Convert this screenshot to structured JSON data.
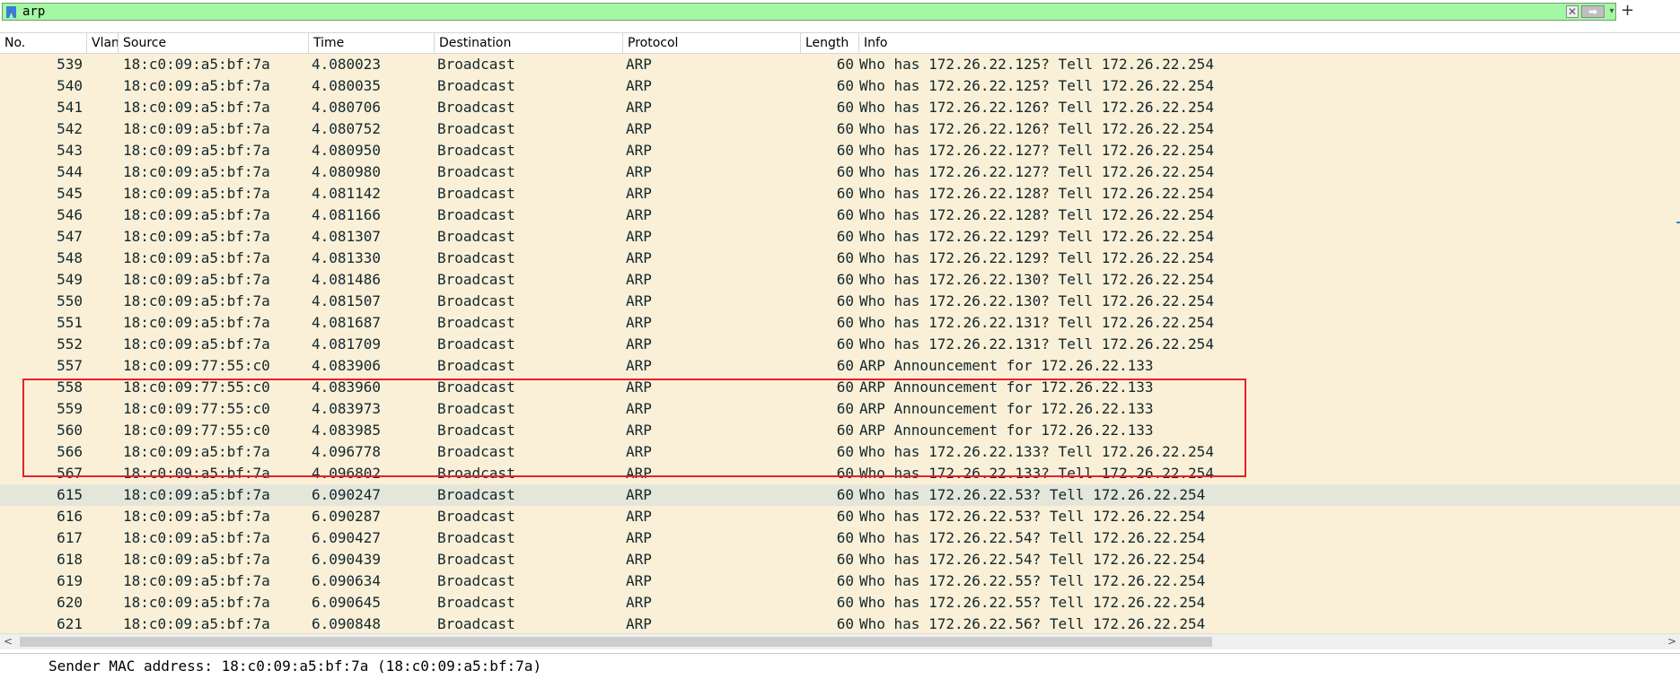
{
  "filter": {
    "value": "arp",
    "icons": [
      "bookmark-icon",
      "clear-icon",
      "apply-arrow-icon",
      "dropdown-icon",
      "plus-icon"
    ],
    "clear_glyph": "✕",
    "apply_glyph": "➡",
    "dropdown_glyph": "▾",
    "plus_glyph": "+"
  },
  "columns": [
    "No.",
    "Vlan",
    "Source",
    "Time",
    "Destination",
    "Protocol",
    "Length",
    "Info"
  ],
  "packets": [
    {
      "no": "539",
      "source": "18:c0:09:a5:bf:7a",
      "time": "4.080023",
      "destination": "Broadcast",
      "protocol": "ARP",
      "length": "60",
      "info": "Who has 172.26.22.125? Tell 172.26.22.254"
    },
    {
      "no": "540",
      "source": "18:c0:09:a5:bf:7a",
      "time": "4.080035",
      "destination": "Broadcast",
      "protocol": "ARP",
      "length": "60",
      "info": "Who has 172.26.22.125? Tell 172.26.22.254"
    },
    {
      "no": "541",
      "source": "18:c0:09:a5:bf:7a",
      "time": "4.080706",
      "destination": "Broadcast",
      "protocol": "ARP",
      "length": "60",
      "info": "Who has 172.26.22.126? Tell 172.26.22.254"
    },
    {
      "no": "542",
      "source": "18:c0:09:a5:bf:7a",
      "time": "4.080752",
      "destination": "Broadcast",
      "protocol": "ARP",
      "length": "60",
      "info": "Who has 172.26.22.126? Tell 172.26.22.254"
    },
    {
      "no": "543",
      "source": "18:c0:09:a5:bf:7a",
      "time": "4.080950",
      "destination": "Broadcast",
      "protocol": "ARP",
      "length": "60",
      "info": "Who has 172.26.22.127? Tell 172.26.22.254"
    },
    {
      "no": "544",
      "source": "18:c0:09:a5:bf:7a",
      "time": "4.080980",
      "destination": "Broadcast",
      "protocol": "ARP",
      "length": "60",
      "info": "Who has 172.26.22.127? Tell 172.26.22.254"
    },
    {
      "no": "545",
      "source": "18:c0:09:a5:bf:7a",
      "time": "4.081142",
      "destination": "Broadcast",
      "protocol": "ARP",
      "length": "60",
      "info": "Who has 172.26.22.128? Tell 172.26.22.254"
    },
    {
      "no": "546",
      "source": "18:c0:09:a5:bf:7a",
      "time": "4.081166",
      "destination": "Broadcast",
      "protocol": "ARP",
      "length": "60",
      "info": "Who has 172.26.22.128? Tell 172.26.22.254"
    },
    {
      "no": "547",
      "source": "18:c0:09:a5:bf:7a",
      "time": "4.081307",
      "destination": "Broadcast",
      "protocol": "ARP",
      "length": "60",
      "info": "Who has 172.26.22.129? Tell 172.26.22.254"
    },
    {
      "no": "548",
      "source": "18:c0:09:a5:bf:7a",
      "time": "4.081330",
      "destination": "Broadcast",
      "protocol": "ARP",
      "length": "60",
      "info": "Who has 172.26.22.129? Tell 172.26.22.254"
    },
    {
      "no": "549",
      "source": "18:c0:09:a5:bf:7a",
      "time": "4.081486",
      "destination": "Broadcast",
      "protocol": "ARP",
      "length": "60",
      "info": "Who has 172.26.22.130? Tell 172.26.22.254"
    },
    {
      "no": "550",
      "source": "18:c0:09:a5:bf:7a",
      "time": "4.081507",
      "destination": "Broadcast",
      "protocol": "ARP",
      "length": "60",
      "info": "Who has 172.26.22.130? Tell 172.26.22.254"
    },
    {
      "no": "551",
      "source": "18:c0:09:a5:bf:7a",
      "time": "4.081687",
      "destination": "Broadcast",
      "protocol": "ARP",
      "length": "60",
      "info": "Who has 172.26.22.131? Tell 172.26.22.254"
    },
    {
      "no": "552",
      "source": "18:c0:09:a5:bf:7a",
      "time": "4.081709",
      "destination": "Broadcast",
      "protocol": "ARP",
      "length": "60",
      "info": "Who has 172.26.22.131? Tell 172.26.22.254"
    },
    {
      "no": "557",
      "source": "18:c0:09:77:55:c0",
      "time": "4.083906",
      "destination": "Broadcast",
      "protocol": "ARP",
      "length": "60",
      "info": "ARP Announcement for 172.26.22.133"
    },
    {
      "no": "558",
      "source": "18:c0:09:77:55:c0",
      "time": "4.083960",
      "destination": "Broadcast",
      "protocol": "ARP",
      "length": "60",
      "info": "ARP Announcement for 172.26.22.133"
    },
    {
      "no": "559",
      "source": "18:c0:09:77:55:c0",
      "time": "4.083973",
      "destination": "Broadcast",
      "protocol": "ARP",
      "length": "60",
      "info": "ARP Announcement for 172.26.22.133"
    },
    {
      "no": "560",
      "source": "18:c0:09:77:55:c0",
      "time": "4.083985",
      "destination": "Broadcast",
      "protocol": "ARP",
      "length": "60",
      "info": "ARP Announcement for 172.26.22.133"
    },
    {
      "no": "566",
      "source": "18:c0:09:a5:bf:7a",
      "time": "4.096778",
      "destination": "Broadcast",
      "protocol": "ARP",
      "length": "60",
      "info": "Who has 172.26.22.133? Tell 172.26.22.254"
    },
    {
      "no": "567",
      "source": "18:c0:09:a5:bf:7a",
      "time": "4.096802",
      "destination": "Broadcast",
      "protocol": "ARP",
      "length": "60",
      "info": "Who has 172.26.22.133? Tell 172.26.22.254"
    },
    {
      "no": "615",
      "source": "18:c0:09:a5:bf:7a",
      "time": "6.090247",
      "destination": "Broadcast",
      "protocol": "ARP",
      "length": "60",
      "info": "Who has 172.26.22.53? Tell 172.26.22.254",
      "selected": true
    },
    {
      "no": "616",
      "source": "18:c0:09:a5:bf:7a",
      "time": "6.090287",
      "destination": "Broadcast",
      "protocol": "ARP",
      "length": "60",
      "info": "Who has 172.26.22.53? Tell 172.26.22.254"
    },
    {
      "no": "617",
      "source": "18:c0:09:a5:bf:7a",
      "time": "6.090427",
      "destination": "Broadcast",
      "protocol": "ARP",
      "length": "60",
      "info": "Who has 172.26.22.54? Tell 172.26.22.254"
    },
    {
      "no": "618",
      "source": "18:c0:09:a5:bf:7a",
      "time": "6.090439",
      "destination": "Broadcast",
      "protocol": "ARP",
      "length": "60",
      "info": "Who has 172.26.22.54? Tell 172.26.22.254"
    },
    {
      "no": "619",
      "source": "18:c0:09:a5:bf:7a",
      "time": "6.090634",
      "destination": "Broadcast",
      "protocol": "ARP",
      "length": "60",
      "info": "Who has 172.26.22.55? Tell 172.26.22.254"
    },
    {
      "no": "620",
      "source": "18:c0:09:a5:bf:7a",
      "time": "6.090645",
      "destination": "Broadcast",
      "protocol": "ARP",
      "length": "60",
      "info": "Who has 172.26.22.55? Tell 172.26.22.254"
    },
    {
      "no": "621",
      "source": "18:c0:09:a5:bf:7a",
      "time": "6.090848",
      "destination": "Broadcast",
      "protocol": "ARP",
      "length": "60",
      "info": "Who has 172.26.22.56? Tell 172.26.22.254"
    }
  ],
  "scrollbar": {
    "left_arrow": "<",
    "right_arrow": ">"
  },
  "details": {
    "text": "Sender MAC address: 18:c0:09:a5:bf:7a (18:c0:09:a5:bf:7a)"
  },
  "colors": {
    "filter_valid_bg": "#a4f7a4",
    "row_bg": "#faf0d7",
    "selected_row_bg": "#e4e6da",
    "highlight_border": "#e8202a"
  }
}
